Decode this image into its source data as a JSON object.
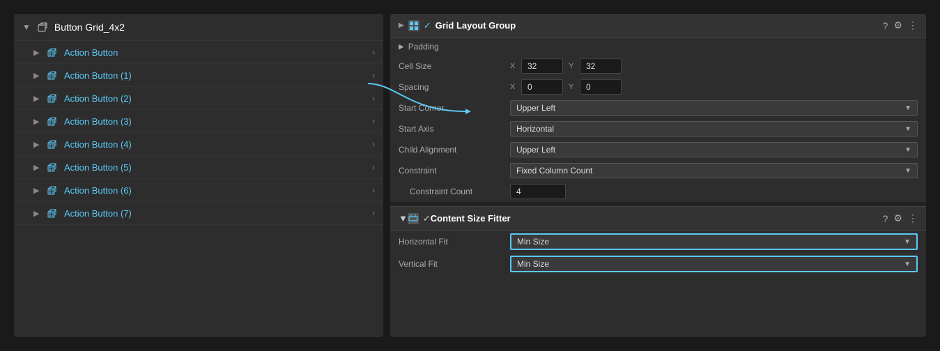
{
  "hierarchy": {
    "root": {
      "label": "Button Grid_4x2",
      "expanded": true
    },
    "items": [
      {
        "label": "Action Button",
        "index": ""
      },
      {
        "label": "Action Button (1)",
        "index": "1"
      },
      {
        "label": "Action Button (2)",
        "index": "2"
      },
      {
        "label": "Action Button (3)",
        "index": "3"
      },
      {
        "label": "Action Button (4)",
        "index": "4"
      },
      {
        "label": "Action Button (5)",
        "index": "5"
      },
      {
        "label": "Action Button (6)",
        "index": "6"
      },
      {
        "label": "Action Button (7)",
        "index": "7"
      }
    ]
  },
  "gridLayout": {
    "title": "Grid Layout Group",
    "padding_label": "Padding",
    "cell_size_label": "Cell Size",
    "cell_size_x": "32",
    "cell_size_y": "32",
    "spacing_label": "Spacing",
    "spacing_x": "0",
    "spacing_y": "0",
    "start_corner_label": "Start Corner",
    "start_corner_value": "Upper Left",
    "start_axis_label": "Start Axis",
    "start_axis_value": "Horizontal",
    "child_alignment_label": "Child Alignment",
    "child_alignment_value": "Upper Left",
    "constraint_label": "Constraint",
    "constraint_value": "Fixed Column Count",
    "constraint_count_label": "Constraint Count",
    "constraint_count_value": "4"
  },
  "contentSizeFitter": {
    "title": "Content Size Fitter",
    "horizontal_fit_label": "Horizontal Fit",
    "horizontal_fit_value": "Min Size",
    "vertical_fit_label": "Vertical Fit",
    "vertical_fit_value": "Min Size"
  },
  "icons": {
    "question": "?",
    "settings": "⚙",
    "more": "⋮",
    "check": "✓",
    "x_label": "X",
    "y_label": "Y"
  }
}
